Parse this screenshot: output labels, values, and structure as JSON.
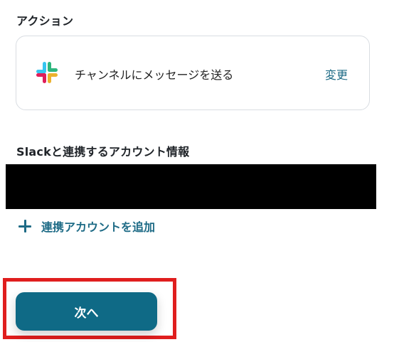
{
  "action_section": {
    "title": "アクション",
    "app_icon": "slack-icon",
    "action_label": "チャンネルにメッセージを送る",
    "change_label": "変更"
  },
  "account_section": {
    "title": "Slackと連携するアカウント情報",
    "add_account_icon": "plus-icon",
    "add_account_label": "連携アカウントを追加"
  },
  "footer": {
    "next_label": "次へ"
  },
  "colors": {
    "accent": "#1e6b86",
    "button": "#0f6a86",
    "highlight": "#e01e1e",
    "redaction": "#000000"
  }
}
